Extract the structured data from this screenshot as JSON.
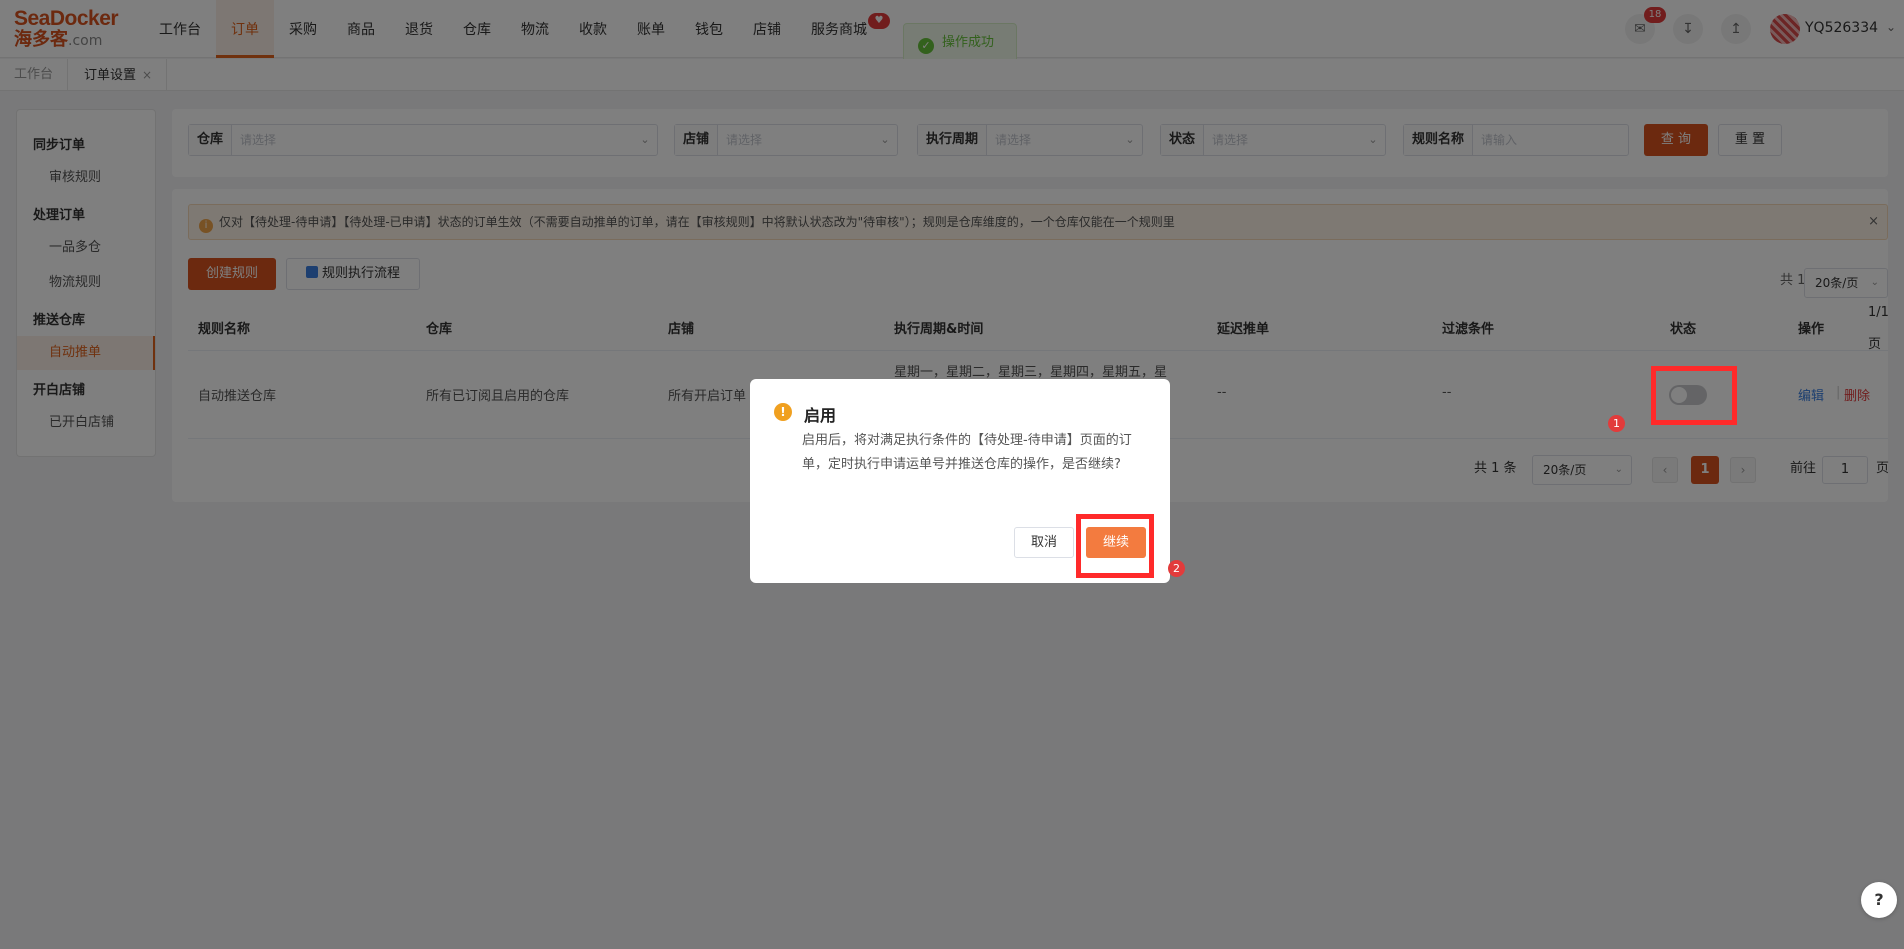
{
  "logo": {
    "line1": "SeaDocker",
    "line2": "海多客",
    "suffix": ".com"
  },
  "nav": {
    "items": [
      "工作台",
      "订单",
      "采购",
      "商品",
      "退货",
      "仓库",
      "物流",
      "收款",
      "账单",
      "钱包",
      "店铺",
      "服务商城"
    ],
    "active": "订单",
    "badge": "♥"
  },
  "toast": {
    "text": "操作成功"
  },
  "header": {
    "notify_count": "18",
    "username": "YQ526334"
  },
  "tabs": [
    {
      "label": "工作台"
    },
    {
      "label": "订单设置",
      "close": "×"
    }
  ],
  "sidebar": {
    "groups": [
      {
        "title": "同步订单",
        "items": [
          "审核规则"
        ]
      },
      {
        "title": "处理订单",
        "items": [
          "一品多仓",
          "物流规则"
        ]
      },
      {
        "title": "推送仓库",
        "items": [
          "自动推单"
        ]
      },
      {
        "title": "开白店铺",
        "items": [
          "已开白店铺"
        ]
      }
    ],
    "active": "自动推单"
  },
  "filters": {
    "warehouse": {
      "label": "仓库",
      "placeholder": "请选择"
    },
    "shop": {
      "label": "店铺",
      "placeholder": "请选择"
    },
    "cycle": {
      "label": "执行周期",
      "placeholder": "请选择"
    },
    "status": {
      "label": "状态",
      "placeholder": "请选择"
    },
    "rule_name": {
      "label": "规则名称",
      "placeholder": "请输入"
    },
    "query": "查 询",
    "reset": "重 置"
  },
  "notice": {
    "text": "仅对【待处理-待申请】【待处理-已申请】状态的订单生效（不需要自动推单的订单，请在【审核规则】中将默认状态改为\"待审核\"）；规则是仓库维度的，一个仓库仅能在一个规则里",
    "close": "×"
  },
  "toolbar": {
    "create": "创建规则",
    "flow": "规则执行流程"
  },
  "pager_top": {
    "total": "共 1 条",
    "page": "第1/1页",
    "size": "20条/页"
  },
  "table": {
    "headers": [
      "规则名称",
      "仓库",
      "店铺",
      "执行周期&时间",
      "延迟推单",
      "过滤条件",
      "状态",
      "操作"
    ],
    "rows": [
      {
        "name": "自动推送仓库",
        "warehouse": "所有已订阅且启用的仓库",
        "shop": "所有开启订单",
        "cycle": "星期一，星期二，星期三，星期四，星期五，星",
        "delay": "--",
        "filter": "--",
        "enabled": false,
        "edit": "编辑",
        "delete": "删除"
      }
    ]
  },
  "pager_bottom": {
    "total": "共 1 条",
    "size": "20条/页",
    "current": "1",
    "goto_label": "前往",
    "goto_value": "1",
    "page_suffix": "页"
  },
  "dialog": {
    "icon": "!",
    "title": "启用",
    "body": "启用后，将对满足执行条件的【待处理-待申请】页面的订单，定时执行申请运单号并推送仓库的操作，是否继续?",
    "cancel": "取消",
    "confirm": "继续"
  },
  "annotations": {
    "marker1": "1",
    "marker2": "2"
  },
  "help": "?",
  "colors": {
    "brand": "#d9531e",
    "confirm": "#f37b3f",
    "highlight": "#ff2a2a",
    "success": "#67c23a"
  }
}
